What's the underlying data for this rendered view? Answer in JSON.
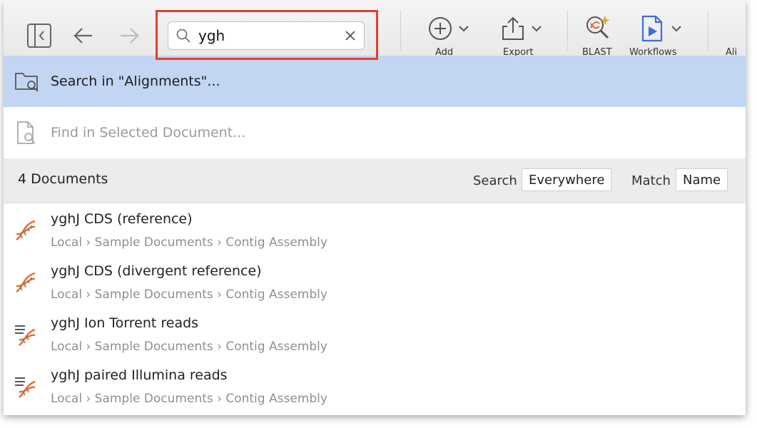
{
  "toolbar": {
    "search_value": "ygh",
    "add_label": "Add",
    "export_label": "Export",
    "blast_label": "BLAST",
    "workflows_label": "Workflows",
    "align_label": "Ali"
  },
  "suggestions": {
    "search_in": "Search in \"Alignments\"...",
    "find_in_selected": "Find in Selected Document..."
  },
  "results": {
    "count_label": "4 Documents",
    "search_label": "Search",
    "search_scope": "Everywhere",
    "match_label": "Match",
    "match_value": "Name",
    "documents": [
      {
        "name": "yghJ CDS (reference)",
        "path": "Local › Sample Documents › Contig Assembly",
        "icon": "dna-sequence-icon"
      },
      {
        "name": "yghJ CDS (divergent reference)",
        "path": "Local › Sample Documents › Contig Assembly",
        "icon": "dna-sequence-icon"
      },
      {
        "name": "yghJ Ion Torrent reads",
        "path": "Local › Sample Documents › Contig Assembly",
        "icon": "sequence-list-icon"
      },
      {
        "name": "yghJ paired Illumina reads",
        "path": "Local › Sample Documents › Contig Assembly",
        "icon": "sequence-list-icon"
      }
    ]
  },
  "colors": {
    "highlight_border": "#e0402c",
    "active_row": "#c2d6f3",
    "toolbar_icon_blue": "#3a6fd8",
    "dna_orange": "#e36b2c"
  }
}
